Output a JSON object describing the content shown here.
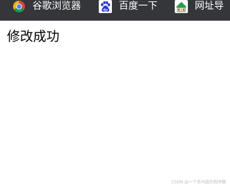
{
  "bookmarks_bar": {
    "items": [
      {
        "label": "谷歌浏览器",
        "icon": "chrome-icon"
      },
      {
        "label": "百度一下",
        "icon": "baidu-paw-icon"
      },
      {
        "label": "网址导",
        "icon": "hao123-icon"
      }
    ]
  },
  "page": {
    "message": "修改成功"
  },
  "watermark": {
    "text": "CSDN @一个名叫追的程序猿"
  },
  "colors": {
    "bookmarks_bar_bg": "#35363a",
    "bookmark_text": "#ffffff",
    "page_bg": "#ffffff",
    "message_text": "#000000",
    "baidu_icon_blue": "#2932e1",
    "chrome_red": "#db4437",
    "chrome_yellow": "#f4b400",
    "chrome_green": "#0f9d58",
    "chrome_blue": "#4285f4"
  }
}
